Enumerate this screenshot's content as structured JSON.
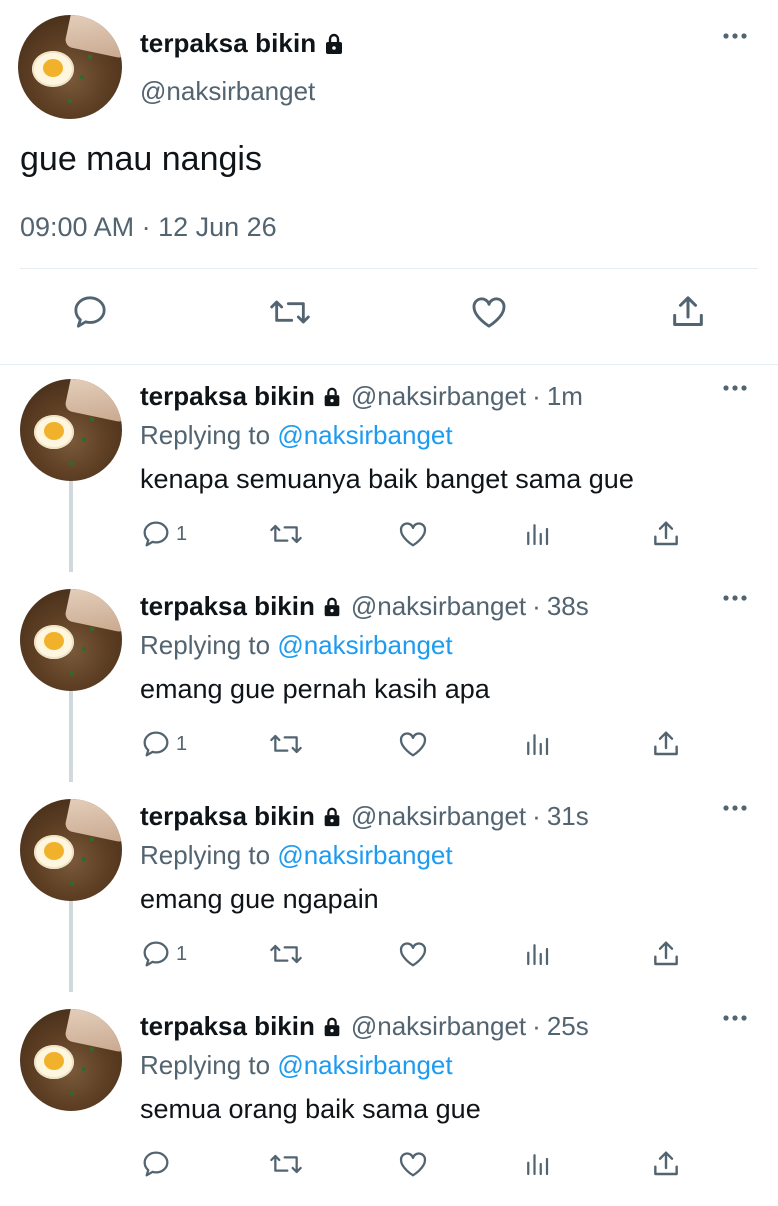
{
  "main_tweet": {
    "author_name": "terpaksa bikin",
    "handle": "@naksirbanget",
    "text": "gue mau nangis",
    "timestamp": "09:00 AM · 12 Jun 26",
    "actions": [
      "reply-icon",
      "retweet-icon",
      "like-icon",
      "share-icon"
    ]
  },
  "replies": [
    {
      "author_name": "terpaksa bikin",
      "handle": "@naksirbanget",
      "separator": "·",
      "time": "1m",
      "replying_prefix": "Replying to",
      "replying_to": "@naksirbanget",
      "text": "kenapa semuanya baik banget sama gue",
      "reply_count": "1"
    },
    {
      "author_name": "terpaksa bikin",
      "handle": "@naksirbanget",
      "separator": "·",
      "time": "38s",
      "replying_prefix": "Replying to",
      "replying_to": "@naksirbanget",
      "text": "emang gue pernah kasih apa",
      "reply_count": "1"
    },
    {
      "author_name": "terpaksa bikin",
      "handle": "@naksirbanget",
      "separator": "·",
      "time": "31s",
      "replying_prefix": "Replying to",
      "replying_to": "@naksirbanget",
      "text": "emang gue ngapain",
      "reply_count": "1"
    },
    {
      "author_name": "terpaksa bikin",
      "handle": "@naksirbanget",
      "separator": "·",
      "time": "25s",
      "replying_prefix": "Replying to",
      "replying_to": "@naksirbanget",
      "text": "semua orang baik sama gue",
      "reply_count": ""
    }
  ],
  "colors": {
    "text": "#0f1419",
    "secondary": "#536471",
    "link": "#1d9bf0",
    "divider": "#e6ecf0",
    "thread_line": "#cfd9de"
  }
}
